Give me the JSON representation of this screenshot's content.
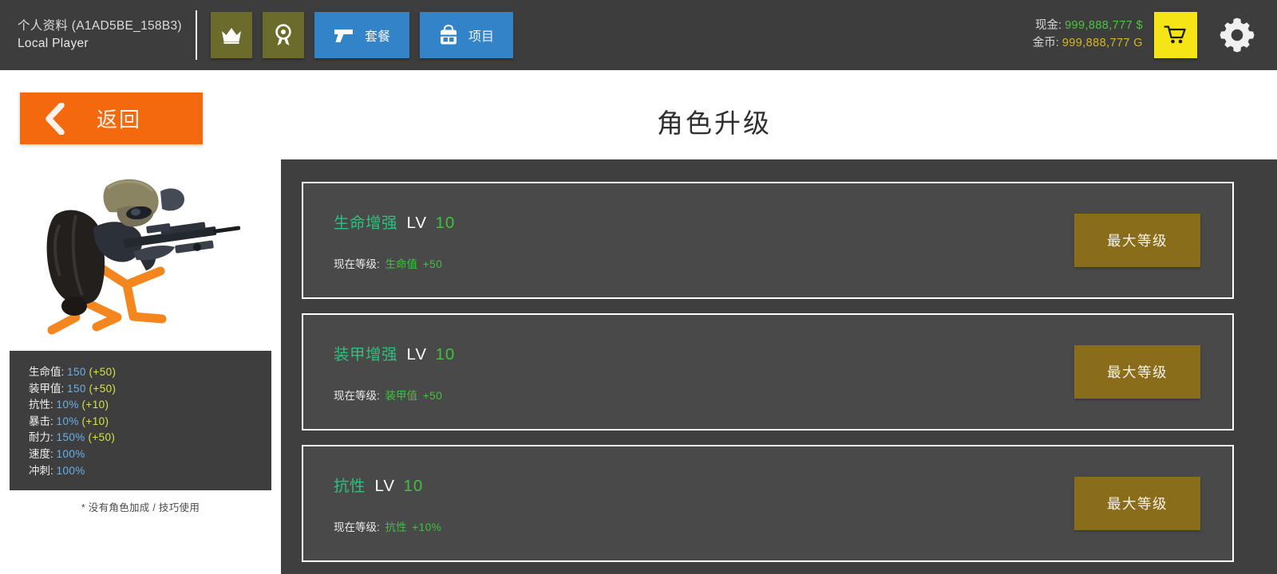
{
  "header": {
    "profile_id": "个人资料 (A1AD5BE_158B3)",
    "profile_sub": "Local Player",
    "buttons": [
      {
        "name": "crown-button",
        "icon": "crown-icon",
        "label": ""
      },
      {
        "name": "award-button",
        "icon": "award-ribbon-icon",
        "label": ""
      },
      {
        "name": "loadout-tab",
        "icon": "pistol-icon",
        "label": "套餐"
      },
      {
        "name": "items-tab",
        "icon": "backpack-icon",
        "label": "项目"
      }
    ],
    "cash_label": "现金:",
    "cash_value": "999,888,777 $",
    "gold_label": "金币:",
    "gold_value": "999,888,777 G",
    "cart_icon": "shopping-cart-icon",
    "gear_icon": "gear-icon"
  },
  "nav": {
    "back_label": "返回",
    "back_icon": "chevron-left-icon",
    "page_title": "角色升级"
  },
  "character": {
    "model_alt": "soldier-character-model",
    "stats": [
      {
        "label": "生命值:",
        "value": "150",
        "bonus": "(+50)"
      },
      {
        "label": "装甲值:",
        "value": "150",
        "bonus": "(+50)"
      },
      {
        "label": "抗性:",
        "value": "10%",
        "bonus": "(+10)"
      },
      {
        "label": "暴击:",
        "value": "10%",
        "bonus": "(+10)"
      },
      {
        "label": "耐力:",
        "value": "150%",
        "bonus": "(+50)"
      },
      {
        "label": "速度:",
        "value": "100%",
        "bonus": ""
      },
      {
        "label": "冲刺:",
        "value": "100%",
        "bonus": ""
      }
    ],
    "footnote": "* 没有角色加成 / 技巧使用"
  },
  "upgrades": {
    "sub_prefix": "现在等级:",
    "max_label": "最大等级",
    "lv_label": "LV",
    "cards": [
      {
        "name": "生命增强",
        "level": "10",
        "stat": "生命值",
        "amount": "+50",
        "button": "最大等级"
      },
      {
        "name": "装甲增强",
        "level": "10",
        "stat": "装甲值",
        "amount": "+50",
        "button": "最大等级"
      },
      {
        "name": "抗性",
        "level": "10",
        "stat": "抗性",
        "amount": "+10%",
        "button": "最大等级"
      }
    ]
  },
  "colors": {
    "header_bg": "#3d3d3d",
    "panel_bg": "#3f3f3f",
    "card_bg": "#494949",
    "accent_orange": "#f4690d",
    "accent_blue": "#3383c9",
    "accent_olive": "#6b6c2b",
    "accent_yellow": "#f5e516",
    "gold_button": "#8a6d1b",
    "green": "#3fc13f",
    "teal": "#2fbf7e",
    "stat_blue": "#6ab0e8",
    "stat_bonus": "#d6e24a",
    "cash_green": "#47c83c",
    "gold_text": "#d3b827"
  }
}
